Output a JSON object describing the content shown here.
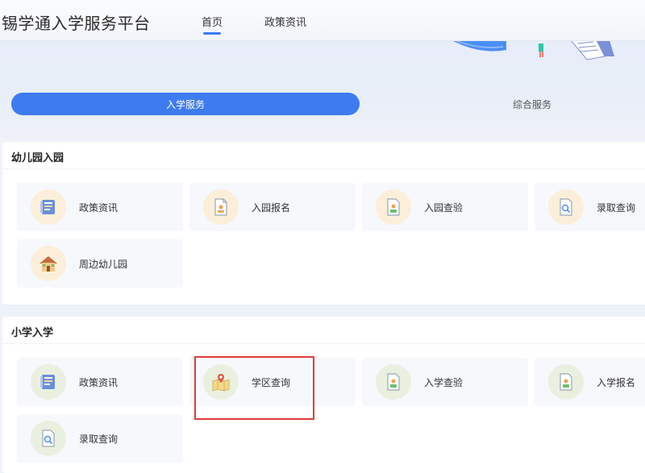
{
  "header": {
    "title": "锡学通入学服务平台",
    "nav": [
      {
        "label": "首页",
        "active": true
      },
      {
        "label": "政策资讯",
        "active": false
      }
    ]
  },
  "tabs": [
    {
      "label": "入学服务",
      "active": true
    },
    {
      "label": "综合服务",
      "active": false
    }
  ],
  "sections": [
    {
      "title": "幼儿园入园",
      "items": [
        {
          "label": "政策资讯",
          "icon": "news-icon"
        },
        {
          "label": "入园报名",
          "icon": "form-icon"
        },
        {
          "label": "入园查验",
          "icon": "id-card-icon"
        },
        {
          "label": "录取查询",
          "icon": "document-search-icon"
        },
        {
          "label": "周边幼儿园",
          "icon": "house-icon"
        }
      ]
    },
    {
      "title": "小学入学",
      "items": [
        {
          "label": "政策资讯",
          "icon": "news-icon"
        },
        {
          "label": "学区查询",
          "icon": "map-pin-icon"
        },
        {
          "label": "入学查验",
          "icon": "id-card-icon"
        },
        {
          "label": "入学报名",
          "icon": "id-card-icon"
        },
        {
          "label": "录取查询",
          "icon": "document-search-icon"
        }
      ]
    }
  ],
  "colors": {
    "accent": "#3d7cf0",
    "highlight": "#e23b3b",
    "kindergarten_icon_bg": "#fbefd9",
    "primary_icon_bg": "#e9f0df"
  }
}
